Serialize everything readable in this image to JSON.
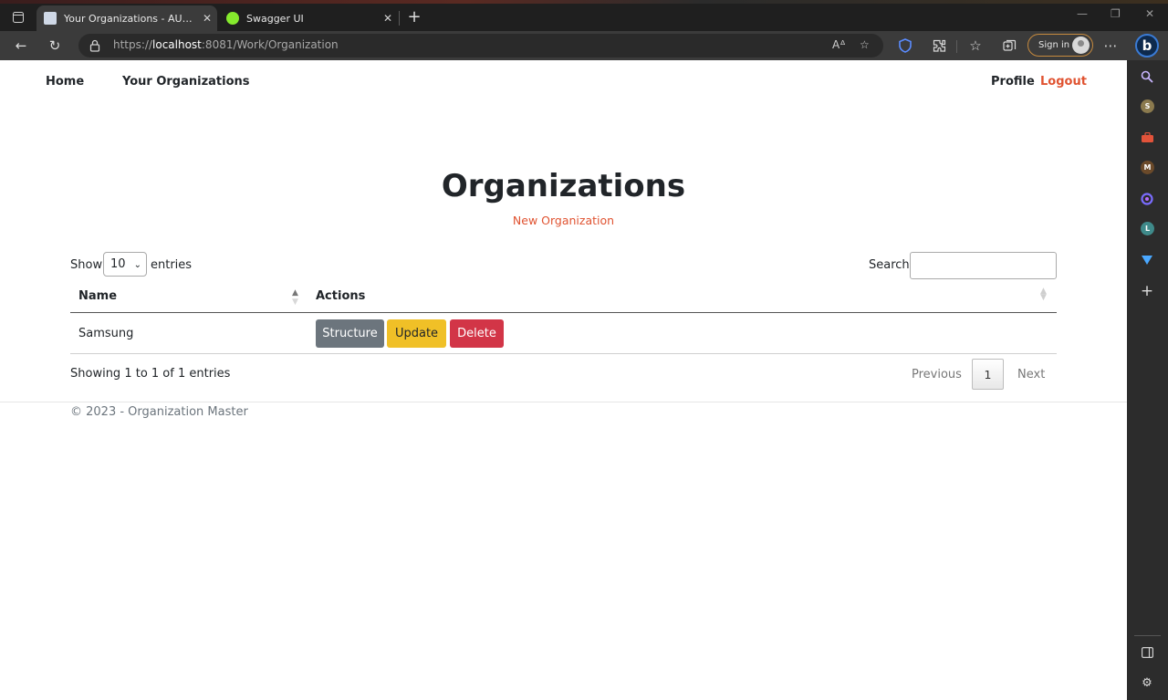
{
  "browser": {
    "tabs": [
      {
        "title": "Your Organizations - AUA.Project",
        "active": true
      },
      {
        "title": "Swagger UI",
        "active": false
      }
    ],
    "url_prefix": "https://",
    "url_host": "localhost",
    "url_rest": ":8081/Work/Organization",
    "signin_label": "Sign in",
    "bing_label": "b",
    "sidebar_badges": [
      "S",
      "M",
      "L"
    ],
    "colors": {
      "frame": "#1f1f1f",
      "toolbar": "#3b3b3b",
      "sidebar": "#2c2c2c"
    }
  },
  "nav": {
    "home": "Home",
    "your_organizations": "Your Organizations",
    "profile": "Profile",
    "logout": "Logout"
  },
  "page": {
    "title": "Organizations",
    "new_link": "New Organization"
  },
  "table_controls": {
    "show_label": "Show",
    "length_value": "10",
    "entries_label": "entries",
    "search_label": "Search:",
    "search_value": ""
  },
  "table": {
    "columns": [
      "Name",
      "Actions"
    ],
    "rows": [
      {
        "name": "Samsung",
        "actions": [
          "Structure",
          "Update",
          "Delete"
        ]
      }
    ]
  },
  "pagination": {
    "info": "Showing 1 to 1 of 1 entries",
    "previous": "Previous",
    "current": "1",
    "next": "Next"
  },
  "footer": {
    "text": "© 2023 - Organization Master"
  },
  "colors": {
    "accent": "#e05331",
    "structure_btn": "#6c757d",
    "update_btn": "#f0c027",
    "delete_btn": "#d23547"
  }
}
